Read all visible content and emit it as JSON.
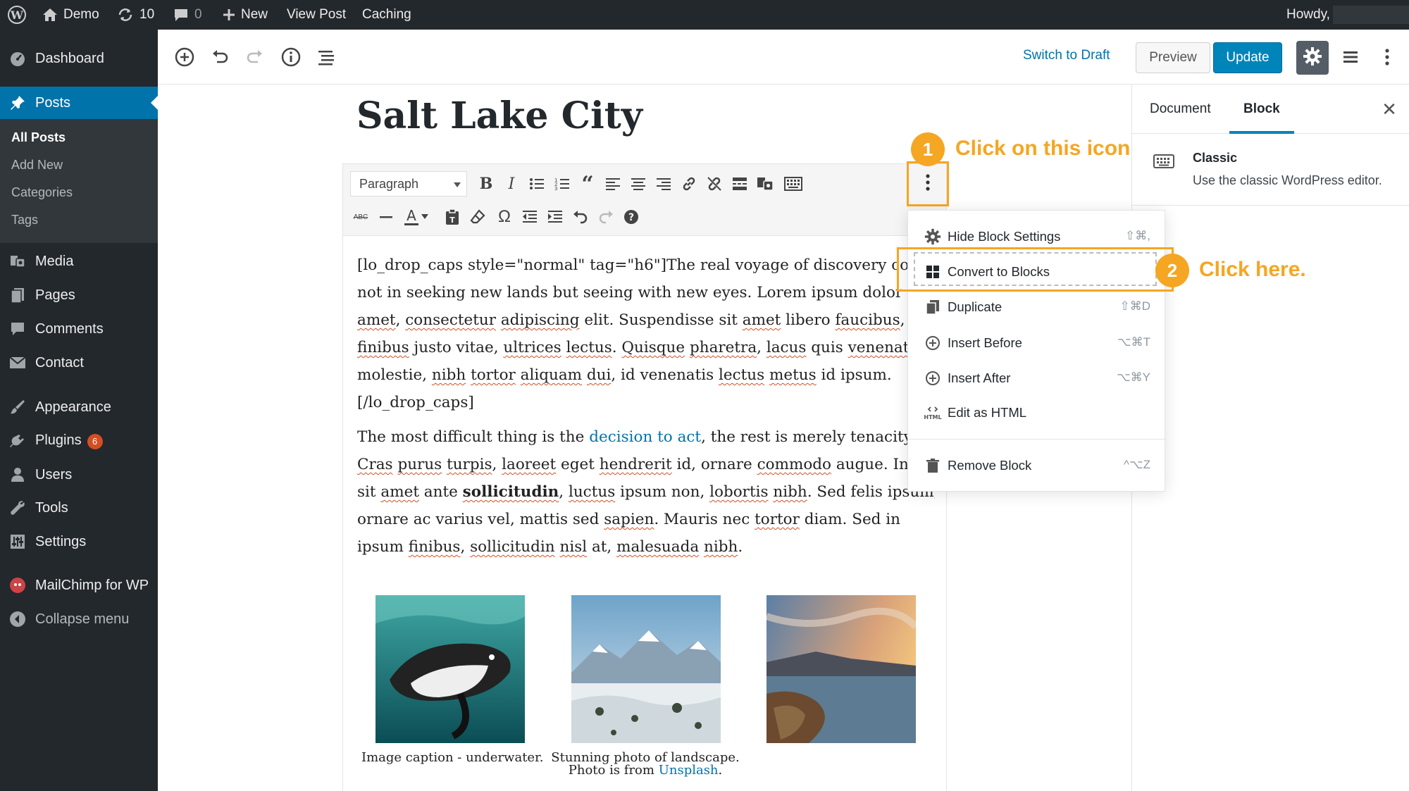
{
  "admin_bar": {
    "site_name": "Demo",
    "updates_count": "10",
    "comments_count": "0",
    "new_label": "New",
    "view_post_label": "View Post",
    "caching_label": "Caching",
    "howdy_label": "Howdy,"
  },
  "sidebar": {
    "dashboard": "Dashboard",
    "posts": "Posts",
    "posts_submenu": [
      "All Posts",
      "Add New",
      "Categories",
      "Tags"
    ],
    "media": "Media",
    "pages": "Pages",
    "comments": "Comments",
    "contact": "Contact",
    "appearance": "Appearance",
    "plugins": "Plugins",
    "plugins_badge": "6",
    "users": "Users",
    "tools": "Tools",
    "settings": "Settings",
    "mailchimp": "MailChimp for WP",
    "collapse": "Collapse menu"
  },
  "header": {
    "switch_to_draft": "Switch to Draft",
    "preview": "Preview",
    "update": "Update"
  },
  "settings_sidebar": {
    "tab_document": "Document",
    "tab_block": "Block",
    "block_title": "Classic",
    "block_description": "Use the classic WordPress editor."
  },
  "post": {
    "title": "Salt Lake City",
    "format_select": "Paragraph",
    "paragraph1": {
      "line1": "[lo_drop_caps style=\"normal\" tag=\"h6\"]The real voyage of discovery cons",
      "line2a": "not in seeking new lands but seeing with new eyes. Lorem ipsum dolor si",
      "line3a": "amet",
      "line3b": ", ",
      "line3c": "consectetur",
      "line3d": " ",
      "line3e": "adipiscing",
      "line3f": " elit. Suspendisse sit ",
      "line3g": "amet",
      "line3h": " libero ",
      "line3i": "faucibus",
      "line3j": ",",
      "line4a": "finibus",
      "line4b": " justo vitae, ",
      "line4c": "ultrices",
      "line4d": " ",
      "line4e": "lectus",
      "line4f": ". ",
      "line4g": "Quisque",
      "line4h": " ",
      "line4i": "pharetra",
      "line4j": ", ",
      "line4k": "lacus",
      "line4l": " quis ",
      "line4m": "venenatis",
      "line5a": "molestie, ",
      "line5b": "nibh",
      "line5c": " ",
      "line5d": "tortor",
      "line5e": " ",
      "line5f": "aliquam",
      "line5g": " ",
      "line5h": "dui",
      "line5i": ", id venenatis ",
      "line5j": "lectus",
      "line5k": " ",
      "line5l": "metus",
      "line5m": " id ipsum.",
      "line6": "[/lo_drop_caps]"
    },
    "paragraph2": {
      "line1a": "The most difficult thing is the ",
      "link": "decision to act",
      "line1b": ", the rest is merely tenacity.",
      "line2a": "Cras",
      "line2b": " ",
      "line2c": "purus",
      "line2d": " ",
      "line2e": "turpis",
      "line2f": ", ",
      "line2g": "laoreet",
      "line2h": " eget ",
      "line2i": "hendrerit",
      "line2j": " id, ornare ",
      "line2k": "commodo",
      "line2l": " augue. Inte",
      "line3a": "sit ",
      "line3b": "amet",
      "line3c": " ante ",
      "line3d": "sollicitudin",
      "line3e": ", ",
      "line3f": "luctus",
      "line3g": " ipsum non, ",
      "line3h": "lobortis",
      "line3i": " ",
      "line3j": "nibh",
      "line3k": ". Sed felis ipsum,",
      "line4a": "ornare ac varius vel, mattis sed ",
      "line4b": "sapien",
      "line4c": ". Mauris nec ",
      "line4d": "tortor",
      "line4e": " diam. Sed in",
      "line5a": "ipsum ",
      "line5b": "finibus",
      "line5c": ", ",
      "line5d": "sollicitudin",
      "line5e": " ",
      "line5f": "nisl",
      "line5g": " at, ",
      "line5h": "malesuada",
      "line5i": " ",
      "line5j": "nibh",
      "line5k": "."
    },
    "captions": {
      "image1": "Image caption - underwater.",
      "image2_line1": "Stunning photo of landscape.",
      "image2_line2a": "Photo is from ",
      "image2_link": "Unsplash",
      "image2_line2b": "."
    }
  },
  "block_menu": {
    "items": [
      {
        "label": "Hide Block Settings",
        "shortcut": "⇧⌘,"
      },
      {
        "label": "Convert to Blocks",
        "shortcut": ""
      },
      {
        "label": "Duplicate",
        "shortcut": "⇧⌘D"
      },
      {
        "label": "Insert Before",
        "shortcut": "⌥⌘T"
      },
      {
        "label": "Insert After",
        "shortcut": "⌥⌘Y"
      },
      {
        "label": "Edit as HTML",
        "shortcut": ""
      },
      {
        "label": "Remove Block",
        "shortcut": "^⌥Z"
      }
    ],
    "html_icon_text": "HTML"
  },
  "annotations": {
    "step1_number": "1",
    "step1_text": "Click on this icon",
    "step2_number": "2",
    "step2_text": "Click here."
  },
  "colors": {
    "admin_dark": "#23282d",
    "admin_blue": "#0073aa",
    "annotation_orange": "#f5a623",
    "update_button": "#0085ba"
  }
}
